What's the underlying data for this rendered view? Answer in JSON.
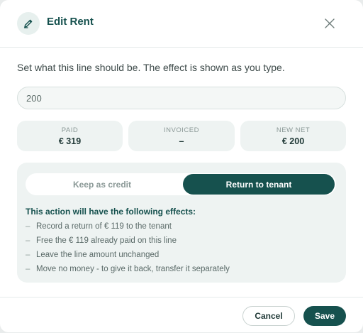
{
  "header": {
    "icon": "edit-pencil-icon",
    "title": "Edit Rent",
    "close_icon": "close-icon"
  },
  "description": "Set what this line should be. The effect is shown as you type.",
  "amount_input": {
    "value": "200"
  },
  "stats": [
    {
      "label": "PAID",
      "value": "€ 319"
    },
    {
      "label": "INVOICED",
      "value": "–"
    },
    {
      "label": "NEW NET",
      "value": "€ 200"
    }
  ],
  "toggle": {
    "options": [
      "Keep as credit",
      "Return to tenant"
    ],
    "selected": "Return to tenant"
  },
  "effects": {
    "title": "This action will have the following effects:",
    "items": [
      "Record a return of € 119 to the tenant",
      "Free the € 119 already paid on this line",
      "Leave the line amount unchanged",
      "Move no money - to give it back, transfer it separately"
    ]
  },
  "footer": {
    "cancel_label": "Cancel",
    "save_label": "Save"
  },
  "colors": {
    "primary": "#16514e",
    "panel": "#eef3f2",
    "text": "#3d4a49"
  }
}
